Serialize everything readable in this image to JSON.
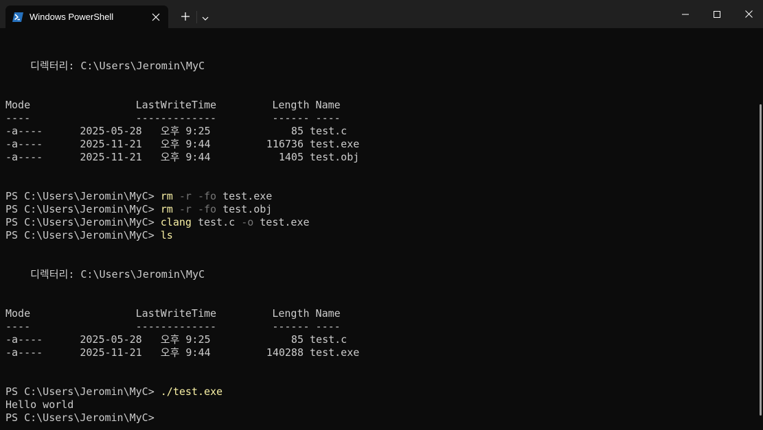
{
  "window": {
    "tab_title": "Windows PowerShell",
    "tab_icon": "powershell-icon",
    "new_tab_icon": "plus-icon",
    "dropdown_icon": "chevron-down-icon",
    "minimize_icon": "minimize-icon",
    "maximize_icon": "maximize-icon",
    "close_icon": "close-icon"
  },
  "colors": {
    "terminal_background": "#0c0c0c",
    "titlebar_background": "#202020",
    "text": "#cccccc",
    "command": "#f9f1a5",
    "parameter": "#767676",
    "icon_blue": "#2671be"
  },
  "terminal": {
    "dir1": "    디렉터리: C:\\Users\\Jeromin\\MyC",
    "hdr1": "Mode                 LastWriteTime         Length Name",
    "sep1": "----                 -------------         ------ ----",
    "files1": [
      "-a----      2025-05-28   오후 9:25             85 test.c",
      "-a----      2025-11-21   오후 9:44         116736 test.exe",
      "-a----      2025-11-21   오후 9:44           1405 test.obj"
    ],
    "cmd1": {
      "prompt": "PS C:\\Users\\Jeromin\\MyC> ",
      "c": "rm",
      "s1": " ",
      "p1": "-r",
      "s2": " ",
      "p2": "-fo",
      "rest": " test.exe"
    },
    "cmd2": {
      "prompt": "PS C:\\Users\\Jeromin\\MyC> ",
      "c": "rm",
      "s1": " ",
      "p1": "-r",
      "s2": " ",
      "p2": "-fo",
      "rest": " test.obj"
    },
    "cmd3": {
      "prompt": "PS C:\\Users\\Jeromin\\MyC> ",
      "c": "clang",
      "a": " test.c ",
      "p": "-o",
      "rest": " test.exe"
    },
    "cmd4": {
      "prompt": "PS C:\\Users\\Jeromin\\MyC> ",
      "c": "ls"
    },
    "dir2": "    디렉터리: C:\\Users\\Jeromin\\MyC",
    "hdr2": "Mode                 LastWriteTime         Length Name",
    "sep2": "----                 -------------         ------ ----",
    "files2": [
      "-a----      2025-05-28   오후 9:25             85 test.c",
      "-a----      2025-11-21   오후 9:44         140288 test.exe"
    ],
    "cmd5": {
      "prompt": "PS C:\\Users\\Jeromin\\MyC> ",
      "c": "./test.exe"
    },
    "output": "Hello world",
    "final_prompt": "PS C:\\Users\\Jeromin\\MyC> "
  }
}
